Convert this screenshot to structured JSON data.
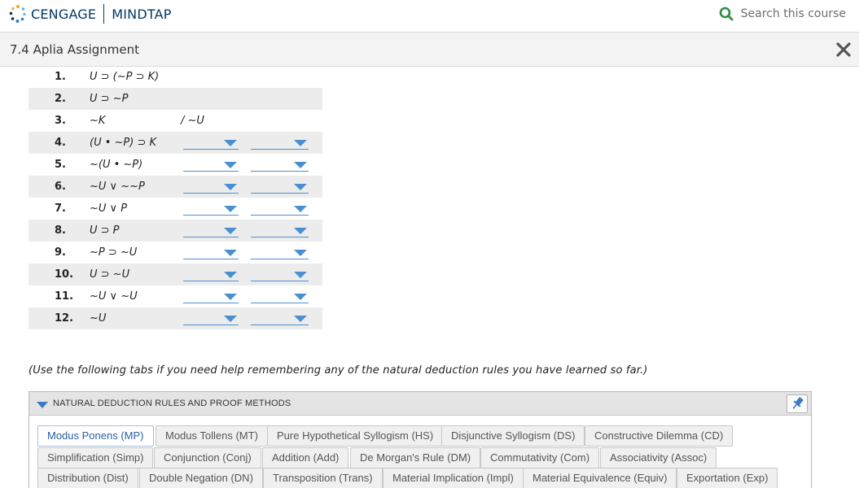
{
  "header": {
    "brand": "CENGAGE",
    "product": "MINDTAP",
    "search_label": "Search this course",
    "search_icon": "search-icon"
  },
  "titlebar": {
    "title": "7.4 Aplia Assignment",
    "close_icon": "close-icon"
  },
  "proof": {
    "conclusion": "/ ~U",
    "lines": [
      {
        "num": "1.",
        "formula": "U ⊃ (~P ⊃ K)",
        "dropdowns": false
      },
      {
        "num": "2.",
        "formula": "U ⊃ ~P",
        "dropdowns": false
      },
      {
        "num": "3.",
        "formula": "~K",
        "dropdowns": false
      },
      {
        "num": "4.",
        "formula": "(U • ~P) ⊃ K",
        "dropdowns": true
      },
      {
        "num": "5.",
        "formula": "~(U • ~P)",
        "dropdowns": true
      },
      {
        "num": "6.",
        "formula": "~U ∨ ~~P",
        "dropdowns": true
      },
      {
        "num": "7.",
        "formula": "~U ∨ P",
        "dropdowns": true
      },
      {
        "num": "8.",
        "formula": "U ⊃ P",
        "dropdowns": true
      },
      {
        "num": "9.",
        "formula": "~P ⊃ ~U",
        "dropdowns": true
      },
      {
        "num": "10.",
        "formula": "U ⊃ ~U",
        "dropdowns": true
      },
      {
        "num": "11.",
        "formula": "~U ∨ ~U",
        "dropdowns": true
      },
      {
        "num": "12.",
        "formula": "~U",
        "dropdowns": true
      }
    ]
  },
  "note": "(Use the following tabs if you need help remembering any of the natural deduction rules you have learned so far.)",
  "rules_panel": {
    "title": "NATURAL DEDUCTION RULES AND PROOF METHODS",
    "pin_icon": "pin-icon",
    "active_tab": "Modus Ponens (MP)",
    "rows": [
      [
        "Modus Ponens (MP)",
        "Modus Tollens (MT)",
        "Pure Hypothetical Syllogism (HS)",
        "Disjunctive Syllogism (DS)",
        "Constructive Dilemma (CD)"
      ],
      [
        "Simplification (Simp)",
        "Conjunction (Conj)",
        "Addition (Add)",
        "De Morgan's Rule (DM)",
        "Commutativity (Com)",
        "Associativity (Assoc)"
      ],
      [
        "Distribution (Dist)",
        "Double Negation (DN)",
        "Transposition (Trans)",
        "Material Implication (Impl)",
        "Material Equivalence (Equiv)",
        "Exportation (Exp)"
      ]
    ]
  },
  "colors": {
    "brand": "#003865",
    "accent": "#4a8fd1",
    "search_icon": "#2e8b3e"
  }
}
